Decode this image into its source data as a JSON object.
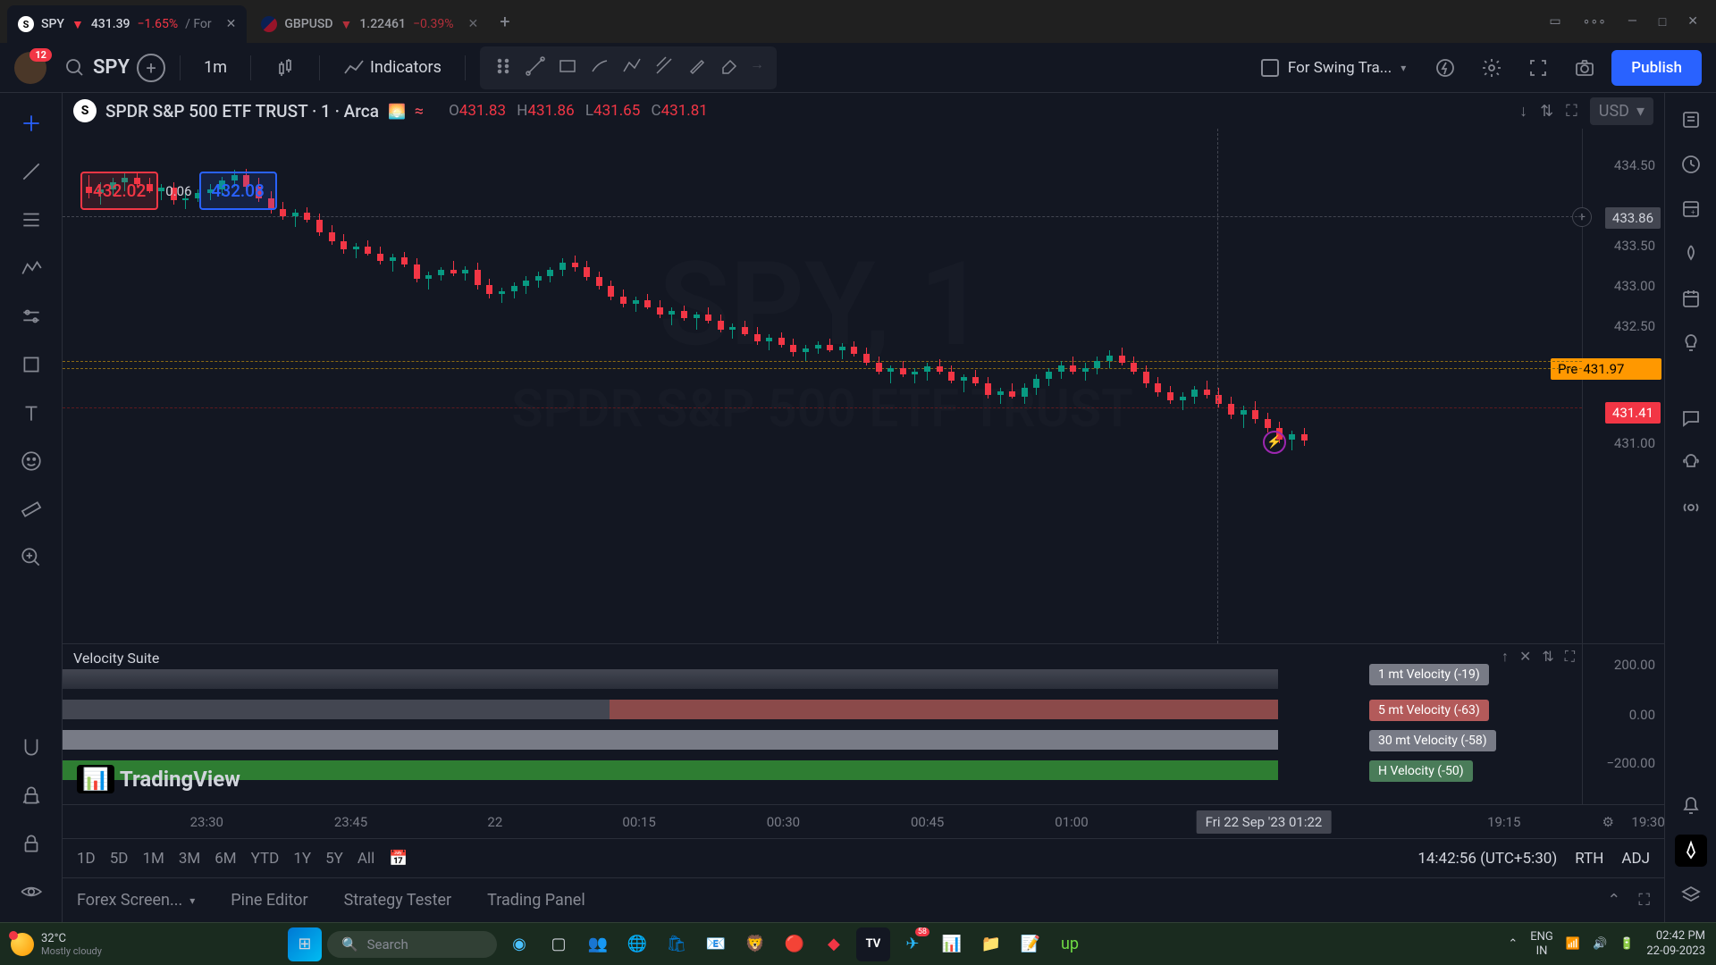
{
  "tabs": [
    {
      "symbol": "SPY",
      "arrow": "▼",
      "price": "431.39",
      "change": "−1.65%",
      "extra": "/ For"
    },
    {
      "symbol": "GBPUSD",
      "arrow": "▼",
      "price": "1.22461",
      "change": "−0.39%"
    }
  ],
  "avatar_badge": "12",
  "search_symbol": "SPY",
  "interval": "1m",
  "indicators_label": "Indicators",
  "layout_name": "For Swing Tra...",
  "publish_label": "Publish",
  "chart_header": {
    "symbol_letter": "S",
    "title": "SPDR S&P 500 ETF TRUST · 1 · Arca",
    "ohlc": {
      "O": "431.83",
      "H": "431.86",
      "L": "431.65",
      "C": "431.81"
    },
    "currency": "USD"
  },
  "watermark1": "SPY, 1",
  "watermark2": "SPDR S&P 500 ETF TRUST",
  "bid": "432.02",
  "spread": "0.06",
  "ask": "432.08",
  "price_ticks": [
    "434.50",
    "433.50",
    "433.00",
    "432.50",
    "431.00"
  ],
  "cursor_price": "433.86",
  "pre_label": "Pre",
  "pre_price": "431.97",
  "last_price": "431.41",
  "indicator": {
    "title": "Velocity Suite",
    "labels": [
      {
        "text": "1 mt Velocity (-19)",
        "bg": "#787b86"
      },
      {
        "text": "5 mt Velocity (-63)",
        "bg": "#b35a5a"
      },
      {
        "text": "30 mt Velocity (-58)",
        "bg": "#787b86"
      },
      {
        "text": "H Velocity (-50)",
        "bg": "#4a7c59"
      }
    ],
    "ticks": [
      "200.00",
      "0.00",
      "−200.00"
    ]
  },
  "time_ticks": [
    {
      "x": 9,
      "label": "23:30"
    },
    {
      "x": 18,
      "label": "23:45"
    },
    {
      "x": 27,
      "label": "22"
    },
    {
      "x": 36,
      "label": "00:15"
    },
    {
      "x": 45,
      "label": "00:30"
    },
    {
      "x": 54,
      "label": "00:45"
    },
    {
      "x": 63,
      "label": "01:00"
    },
    {
      "x": 90,
      "label": "19:15"
    },
    {
      "x": 99,
      "label": "19:30"
    }
  ],
  "time_cursor": "Fri 22 Sep '23    01:22",
  "ranges": [
    "1D",
    "5D",
    "1M",
    "3M",
    "6M",
    "YTD",
    "1Y",
    "5Y",
    "All"
  ],
  "clock": "14:42:56 (UTC+5:30)",
  "rth": "RTH",
  "adj": "ADJ",
  "bottom_tabs": [
    "Forex Screen...",
    "Pine Editor",
    "Strategy Tester",
    "Trading Panel"
  ],
  "taskbar": {
    "temp": "32°C",
    "weather": "Mostly cloudy",
    "search_placeholder": "Search",
    "lang1": "ENG",
    "lang2": "IN",
    "time": "02:42 PM",
    "date": "22-09-2023"
  },
  "chart_data": {
    "type": "candlestick",
    "title": "SPDR S&P 500 ETF TRUST",
    "symbol": "SPY",
    "interval": "1m",
    "ylim": [
      430.8,
      434.6
    ],
    "candles": [
      {
        "x": 1.5,
        "o": 434.25,
        "h": 434.38,
        "l": 434.12,
        "c": 434.18,
        "col": "r"
      },
      {
        "x": 2.3,
        "o": 434.18,
        "h": 434.3,
        "l": 434.05,
        "c": 434.22,
        "col": "g"
      },
      {
        "x": 3.1,
        "o": 434.22,
        "h": 434.35,
        "l": 434.15,
        "c": 434.3,
        "col": "g"
      },
      {
        "x": 3.9,
        "o": 434.3,
        "h": 434.4,
        "l": 434.2,
        "c": 434.35,
        "col": "g"
      },
      {
        "x": 4.7,
        "o": 434.35,
        "h": 434.42,
        "l": 434.25,
        "c": 434.28,
        "col": "r"
      },
      {
        "x": 5.5,
        "o": 434.28,
        "h": 434.35,
        "l": 434.18,
        "c": 434.2,
        "col": "r"
      },
      {
        "x": 6.3,
        "o": 434.2,
        "h": 434.28,
        "l": 434.1,
        "c": 434.24,
        "col": "g"
      },
      {
        "x": 7.1,
        "o": 434.24,
        "h": 434.3,
        "l": 434.05,
        "c": 434.1,
        "col": "r"
      },
      {
        "x": 7.9,
        "o": 434.1,
        "h": 434.18,
        "l": 434.0,
        "c": 434.12,
        "col": "g"
      },
      {
        "x": 8.7,
        "o": 434.12,
        "h": 434.22,
        "l": 434.08,
        "c": 434.18,
        "col": "g"
      },
      {
        "x": 9.5,
        "o": 434.18,
        "h": 434.28,
        "l": 434.1,
        "c": 434.22,
        "col": "g"
      },
      {
        "x": 10.3,
        "o": 434.22,
        "h": 434.36,
        "l": 434.15,
        "c": 434.32,
        "col": "g"
      },
      {
        "x": 11.1,
        "o": 434.32,
        "h": 434.44,
        "l": 434.25,
        "c": 434.38,
        "col": "g"
      },
      {
        "x": 11.9,
        "o": 434.38,
        "h": 434.45,
        "l": 434.2,
        "c": 434.25,
        "col": "r"
      },
      {
        "x": 12.7,
        "o": 434.25,
        "h": 434.35,
        "l": 434.08,
        "c": 434.12,
        "col": "r"
      },
      {
        "x": 13.5,
        "o": 434.12,
        "h": 434.2,
        "l": 433.95,
        "c": 434.0,
        "col": "r"
      },
      {
        "x": 14.3,
        "o": 434.0,
        "h": 434.08,
        "l": 433.88,
        "c": 433.92,
        "col": "r"
      },
      {
        "x": 15.1,
        "o": 433.92,
        "h": 434.0,
        "l": 433.8,
        "c": 433.96,
        "col": "g"
      },
      {
        "x": 15.9,
        "o": 433.96,
        "h": 434.02,
        "l": 433.85,
        "c": 433.88,
        "col": "r"
      },
      {
        "x": 16.7,
        "o": 433.88,
        "h": 433.95,
        "l": 433.7,
        "c": 433.74,
        "col": "r"
      },
      {
        "x": 17.5,
        "o": 433.74,
        "h": 433.82,
        "l": 433.6,
        "c": 433.64,
        "col": "r"
      },
      {
        "x": 18.3,
        "o": 433.64,
        "h": 433.72,
        "l": 433.5,
        "c": 433.55,
        "col": "r"
      },
      {
        "x": 19.1,
        "o": 433.55,
        "h": 433.62,
        "l": 433.45,
        "c": 433.58,
        "col": "g"
      },
      {
        "x": 19.9,
        "o": 433.58,
        "h": 433.65,
        "l": 433.48,
        "c": 433.5,
        "col": "r"
      },
      {
        "x": 20.7,
        "o": 433.5,
        "h": 433.58,
        "l": 433.38,
        "c": 433.42,
        "col": "r"
      },
      {
        "x": 21.5,
        "o": 433.42,
        "h": 433.5,
        "l": 433.3,
        "c": 433.46,
        "col": "g"
      },
      {
        "x": 22.3,
        "o": 433.46,
        "h": 433.52,
        "l": 433.35,
        "c": 433.38,
        "col": "r"
      },
      {
        "x": 23.1,
        "o": 433.38,
        "h": 433.45,
        "l": 433.18,
        "c": 433.22,
        "col": "r"
      },
      {
        "x": 23.9,
        "o": 433.22,
        "h": 433.3,
        "l": 433.1,
        "c": 433.26,
        "col": "g"
      },
      {
        "x": 24.7,
        "o": 433.26,
        "h": 433.35,
        "l": 433.2,
        "c": 433.32,
        "col": "g"
      },
      {
        "x": 25.5,
        "o": 433.32,
        "h": 433.42,
        "l": 433.25,
        "c": 433.28,
        "col": "r"
      },
      {
        "x": 26.3,
        "o": 433.28,
        "h": 433.36,
        "l": 433.2,
        "c": 433.32,
        "col": "g"
      },
      {
        "x": 27.1,
        "o": 433.32,
        "h": 433.4,
        "l": 433.1,
        "c": 433.15,
        "col": "r"
      },
      {
        "x": 27.9,
        "o": 433.15,
        "h": 433.22,
        "l": 433.0,
        "c": 433.05,
        "col": "r"
      },
      {
        "x": 28.7,
        "o": 433.05,
        "h": 433.12,
        "l": 432.95,
        "c": 433.08,
        "col": "g"
      },
      {
        "x": 29.5,
        "o": 433.08,
        "h": 433.18,
        "l": 433.0,
        "c": 433.14,
        "col": "g"
      },
      {
        "x": 30.3,
        "o": 433.14,
        "h": 433.25,
        "l": 433.05,
        "c": 433.2,
        "col": "g"
      },
      {
        "x": 31.1,
        "o": 433.2,
        "h": 433.3,
        "l": 433.12,
        "c": 433.25,
        "col": "g"
      },
      {
        "x": 31.9,
        "o": 433.25,
        "h": 433.35,
        "l": 433.18,
        "c": 433.32,
        "col": "g"
      },
      {
        "x": 32.7,
        "o": 433.32,
        "h": 433.45,
        "l": 433.25,
        "c": 433.4,
        "col": "g"
      },
      {
        "x": 33.5,
        "o": 433.4,
        "h": 433.48,
        "l": 433.3,
        "c": 433.35,
        "col": "r"
      },
      {
        "x": 34.3,
        "o": 433.35,
        "h": 433.42,
        "l": 433.2,
        "c": 433.24,
        "col": "r"
      },
      {
        "x": 35.1,
        "o": 433.24,
        "h": 433.3,
        "l": 433.1,
        "c": 433.14,
        "col": "r"
      },
      {
        "x": 35.9,
        "o": 433.14,
        "h": 433.2,
        "l": 432.98,
        "c": 433.02,
        "col": "r"
      },
      {
        "x": 36.7,
        "o": 433.02,
        "h": 433.1,
        "l": 432.9,
        "c": 432.94,
        "col": "r"
      },
      {
        "x": 37.5,
        "o": 432.94,
        "h": 433.02,
        "l": 432.85,
        "c": 432.98,
        "col": "g"
      },
      {
        "x": 38.3,
        "o": 432.98,
        "h": 433.05,
        "l": 432.88,
        "c": 432.9,
        "col": "r"
      },
      {
        "x": 39.1,
        "o": 432.9,
        "h": 432.98,
        "l": 432.78,
        "c": 432.82,
        "col": "r"
      },
      {
        "x": 39.9,
        "o": 432.82,
        "h": 432.9,
        "l": 432.7,
        "c": 432.86,
        "col": "g"
      },
      {
        "x": 40.7,
        "o": 432.86,
        "h": 432.92,
        "l": 432.75,
        "c": 432.78,
        "col": "r"
      },
      {
        "x": 41.5,
        "o": 432.78,
        "h": 432.85,
        "l": 432.65,
        "c": 432.82,
        "col": "g"
      },
      {
        "x": 42.3,
        "o": 432.82,
        "h": 432.9,
        "l": 432.72,
        "c": 432.75,
        "col": "r"
      },
      {
        "x": 43.1,
        "o": 432.75,
        "h": 432.82,
        "l": 432.62,
        "c": 432.65,
        "col": "r"
      },
      {
        "x": 43.9,
        "o": 432.65,
        "h": 432.72,
        "l": 432.55,
        "c": 432.68,
        "col": "g"
      },
      {
        "x": 44.7,
        "o": 432.68,
        "h": 432.75,
        "l": 432.58,
        "c": 432.6,
        "col": "r"
      },
      {
        "x": 45.5,
        "o": 432.6,
        "h": 432.68,
        "l": 432.48,
        "c": 432.52,
        "col": "r"
      },
      {
        "x": 46.3,
        "o": 432.52,
        "h": 432.6,
        "l": 432.42,
        "c": 432.56,
        "col": "g"
      },
      {
        "x": 47.1,
        "o": 432.56,
        "h": 432.62,
        "l": 432.45,
        "c": 432.48,
        "col": "r"
      },
      {
        "x": 47.9,
        "o": 432.48,
        "h": 432.55,
        "l": 432.35,
        "c": 432.4,
        "col": "r"
      },
      {
        "x": 48.7,
        "o": 432.4,
        "h": 432.48,
        "l": 432.3,
        "c": 432.44,
        "col": "g"
      },
      {
        "x": 49.5,
        "o": 432.44,
        "h": 432.52,
        "l": 432.38,
        "c": 432.48,
        "col": "g"
      },
      {
        "x": 50.3,
        "o": 432.48,
        "h": 432.55,
        "l": 432.4,
        "c": 432.42,
        "col": "r"
      },
      {
        "x": 51.1,
        "o": 432.42,
        "h": 432.5,
        "l": 432.32,
        "c": 432.46,
        "col": "g"
      },
      {
        "x": 51.9,
        "o": 432.46,
        "h": 432.52,
        "l": 432.35,
        "c": 432.38,
        "col": "r"
      },
      {
        "x": 52.7,
        "o": 432.38,
        "h": 432.45,
        "l": 432.25,
        "c": 432.28,
        "col": "r"
      },
      {
        "x": 53.5,
        "o": 432.28,
        "h": 432.35,
        "l": 432.15,
        "c": 432.18,
        "col": "r"
      },
      {
        "x": 54.3,
        "o": 432.18,
        "h": 432.25,
        "l": 432.05,
        "c": 432.22,
        "col": "g"
      },
      {
        "x": 55.1,
        "o": 432.22,
        "h": 432.3,
        "l": 432.12,
        "c": 432.15,
        "col": "r"
      },
      {
        "x": 55.9,
        "o": 432.15,
        "h": 432.22,
        "l": 432.05,
        "c": 432.18,
        "col": "g"
      },
      {
        "x": 56.7,
        "o": 432.18,
        "h": 432.28,
        "l": 432.08,
        "c": 432.24,
        "col": "g"
      },
      {
        "x": 57.5,
        "o": 432.24,
        "h": 432.32,
        "l": 432.15,
        "c": 432.18,
        "col": "r"
      },
      {
        "x": 58.3,
        "o": 432.18,
        "h": 432.25,
        "l": 432.05,
        "c": 432.08,
        "col": "r"
      },
      {
        "x": 59.1,
        "o": 432.08,
        "h": 432.15,
        "l": 431.95,
        "c": 432.12,
        "col": "g"
      },
      {
        "x": 59.9,
        "o": 432.12,
        "h": 432.2,
        "l": 432.02,
        "c": 432.05,
        "col": "r"
      },
      {
        "x": 60.7,
        "o": 432.05,
        "h": 432.12,
        "l": 431.88,
        "c": 431.92,
        "col": "r"
      },
      {
        "x": 61.5,
        "o": 431.92,
        "h": 432.0,
        "l": 431.82,
        "c": 431.96,
        "col": "g"
      },
      {
        "x": 62.3,
        "o": 431.96,
        "h": 432.05,
        "l": 431.88,
        "c": 431.9,
        "col": "r"
      },
      {
        "x": 63.1,
        "o": 431.9,
        "h": 432.05,
        "l": 431.82,
        "c": 432.0,
        "col": "g"
      },
      {
        "x": 63.9,
        "o": 432.0,
        "h": 432.15,
        "l": 431.92,
        "c": 432.1,
        "col": "g"
      },
      {
        "x": 64.7,
        "o": 432.1,
        "h": 432.22,
        "l": 432.02,
        "c": 432.18,
        "col": "g"
      },
      {
        "x": 65.5,
        "o": 432.18,
        "h": 432.3,
        "l": 432.1,
        "c": 432.25,
        "col": "g"
      },
      {
        "x": 66.3,
        "o": 432.25,
        "h": 432.35,
        "l": 432.15,
        "c": 432.18,
        "col": "r"
      },
      {
        "x": 67.1,
        "o": 432.18,
        "h": 432.28,
        "l": 432.08,
        "c": 432.22,
        "col": "g"
      },
      {
        "x": 67.9,
        "o": 432.22,
        "h": 432.35,
        "l": 432.15,
        "c": 432.3,
        "col": "g"
      },
      {
        "x": 68.7,
        "o": 432.3,
        "h": 432.42,
        "l": 432.22,
        "c": 432.36,
        "col": "g"
      },
      {
        "x": 69.5,
        "o": 432.36,
        "h": 432.45,
        "l": 432.25,
        "c": 432.28,
        "col": "r"
      },
      {
        "x": 70.3,
        "o": 432.28,
        "h": 432.35,
        "l": 432.15,
        "c": 432.18,
        "col": "r"
      },
      {
        "x": 71.1,
        "o": 432.18,
        "h": 432.25,
        "l": 432.0,
        "c": 432.05,
        "col": "r"
      },
      {
        "x": 71.9,
        "o": 432.05,
        "h": 432.12,
        "l": 431.9,
        "c": 431.95,
        "col": "r"
      },
      {
        "x": 72.7,
        "o": 431.95,
        "h": 432.02,
        "l": 431.82,
        "c": 431.86,
        "col": "r"
      },
      {
        "x": 73.5,
        "o": 431.86,
        "h": 431.95,
        "l": 431.75,
        "c": 431.9,
        "col": "g"
      },
      {
        "x": 74.3,
        "o": 431.9,
        "h": 432.02,
        "l": 431.82,
        "c": 431.98,
        "col": "g"
      },
      {
        "x": 75.1,
        "o": 431.98,
        "h": 432.08,
        "l": 431.88,
        "c": 431.92,
        "col": "r"
      },
      {
        "x": 75.9,
        "o": 431.92,
        "h": 432.0,
        "l": 431.78,
        "c": 431.82,
        "col": "r"
      },
      {
        "x": 76.7,
        "o": 431.82,
        "h": 431.9,
        "l": 431.65,
        "c": 431.7,
        "col": "r"
      },
      {
        "x": 77.5,
        "o": 431.7,
        "h": 431.8,
        "l": 431.55,
        "c": 431.75,
        "col": "g"
      },
      {
        "x": 78.3,
        "o": 431.75,
        "h": 431.85,
        "l": 431.6,
        "c": 431.65,
        "col": "r"
      },
      {
        "x": 79.1,
        "o": 431.65,
        "h": 431.72,
        "l": 431.5,
        "c": 431.55,
        "col": "r"
      },
      {
        "x": 79.9,
        "o": 431.55,
        "h": 431.62,
        "l": 431.38,
        "c": 431.42,
        "col": "r"
      },
      {
        "x": 80.7,
        "o": 431.42,
        "h": 431.52,
        "l": 431.3,
        "c": 431.48,
        "col": "g"
      },
      {
        "x": 81.5,
        "o": 431.48,
        "h": 431.55,
        "l": 431.35,
        "c": 431.41,
        "col": "r"
      }
    ]
  }
}
